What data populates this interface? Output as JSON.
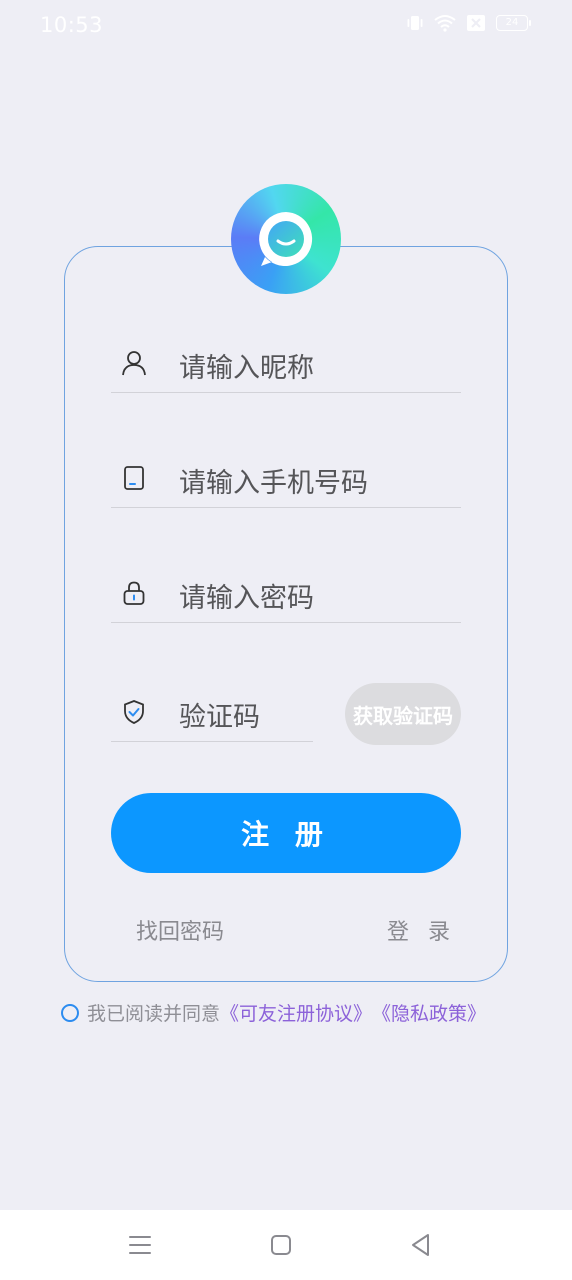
{
  "status_bar": {
    "time": "10:53",
    "battery_level": "24",
    "icons": [
      "vibrate-icon",
      "wifi-icon",
      "sim-x-icon",
      "battery-icon"
    ]
  },
  "logo": {
    "icon": "chat-bubble-smile-logo"
  },
  "form": {
    "nickname": {
      "icon": "user-icon",
      "placeholder": "请输入昵称"
    },
    "phone": {
      "icon": "phone-icon",
      "placeholder": "请输入手机号码"
    },
    "password": {
      "icon": "lock-icon",
      "placeholder": "请输入密码"
    },
    "code": {
      "icon": "shield-check-icon",
      "placeholder": "验证码"
    },
    "get_code_label": "获取验证码",
    "register_label": "注 册"
  },
  "links": {
    "forgot_password": "找回密码",
    "login": "登 录"
  },
  "agreement": {
    "prefix": "我已阅读并同意",
    "user_agreement": "《可友注册协议》",
    "privacy_policy": "《隐私政策》"
  },
  "nav_bar": {
    "icons": [
      "menu-icon",
      "home-icon",
      "back-icon"
    ]
  },
  "colors": {
    "primary": "#0c97ff",
    "link": "#8c62d9",
    "card_border": "#6fa3e0",
    "background": "#eeeef5"
  }
}
